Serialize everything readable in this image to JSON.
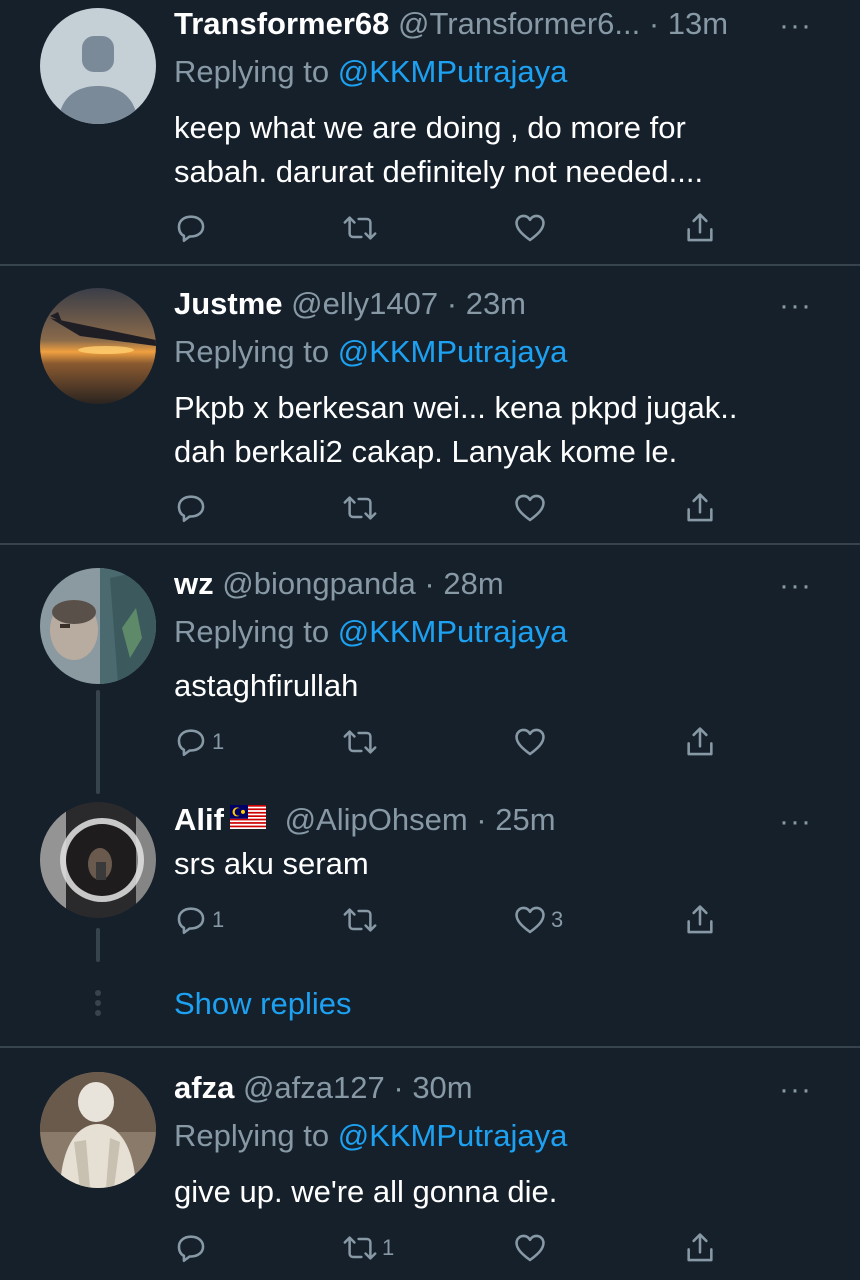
{
  "tweets": [
    {
      "name": "Transformer68",
      "handle": "@Transformer6...",
      "sep": "·",
      "time": "13m",
      "replying_prefix": "Replying to ",
      "replying_to": "@KKMPutrajaya",
      "text": "keep what we are doing , do more for\nsabah. darurat definitely not needed....",
      "avatar": "default-avatar",
      "reply_count": "",
      "retweet_count": "",
      "like_count": ""
    },
    {
      "name": "Justme",
      "handle": "@elly1407",
      "sep": "·",
      "time": "23m",
      "replying_prefix": "Replying to ",
      "replying_to": "@KKMPutrajaya",
      "text": "Pkpb x berkesan wei... kena pkpd jugak..\ndah berkali2 cakap. Lanyak kome le.",
      "avatar": "sunset-wing-photo",
      "reply_count": "",
      "retweet_count": "",
      "like_count": ""
    },
    {
      "name": "wz",
      "handle": "@biongpanda",
      "sep": "·",
      "time": "28m",
      "replying_prefix": "Replying to ",
      "replying_to": "@KKMPutrajaya",
      "text": "astaghfirullah",
      "avatar": "window-selfie-photo",
      "reply_count": "1",
      "retweet_count": "",
      "like_count": ""
    },
    {
      "name": "Alif",
      "handle": "@AlipOhsem",
      "sep": "·",
      "time": "25m",
      "text": "srs aku seram",
      "avatar": "mirror-selfie-photo",
      "flag": "malaysia-flag",
      "reply_count": "1",
      "retweet_count": "",
      "like_count": "3"
    },
    {
      "name": "afza",
      "handle": "@afza127",
      "sep": "·",
      "time": "30m",
      "replying_prefix": "Replying to ",
      "replying_to": "@KKMPutrajaya",
      "text": "give up. we're all gonna die.",
      "avatar": "person-photo",
      "reply_count": "",
      "retweet_count": "1",
      "like_count": ""
    }
  ],
  "thread": {
    "show_replies_label": "Show replies"
  },
  "more_label": "···",
  "icons": {
    "reply": "reply-icon",
    "retweet": "retweet-icon",
    "like": "heart-icon",
    "share": "share-icon",
    "more": "more-options-icon"
  },
  "colors": {
    "background": "#15202b",
    "divider": "#38444d",
    "secondary_text": "#8899a6",
    "link": "#1da1f2",
    "primary_text": "#ffffff"
  }
}
